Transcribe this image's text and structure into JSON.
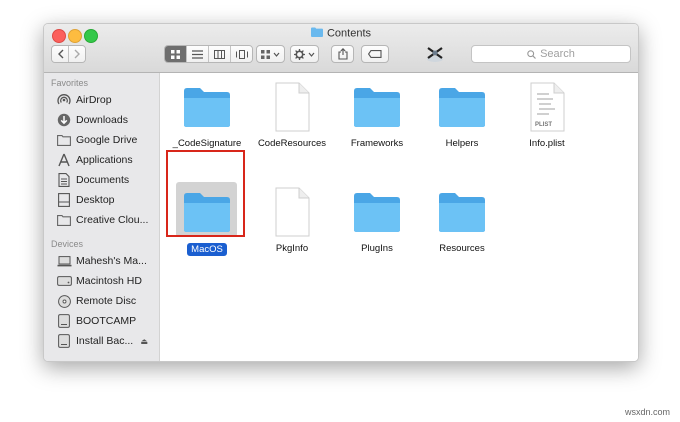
{
  "window": {
    "title": "Contents",
    "search_placeholder": "Search"
  },
  "sidebar": {
    "favorites_heading": "Favorites",
    "favorites": [
      {
        "label": "AirDrop",
        "icon": "airdrop-icon"
      },
      {
        "label": "Downloads",
        "icon": "downloads-icon"
      },
      {
        "label": "Google Drive",
        "icon": "folder-icon"
      },
      {
        "label": "Applications",
        "icon": "applications-icon"
      },
      {
        "label": "Documents",
        "icon": "documents-icon"
      },
      {
        "label": "Desktop",
        "icon": "desktop-icon"
      },
      {
        "label": "Creative Clou...",
        "icon": "folder-icon"
      }
    ],
    "devices_heading": "Devices",
    "devices": [
      {
        "label": "Mahesh's Ma...",
        "icon": "laptop-icon"
      },
      {
        "label": "Macintosh HD",
        "icon": "hard-drive-icon"
      },
      {
        "label": "Remote Disc",
        "icon": "disc-icon"
      },
      {
        "label": "BOOTCAMP",
        "icon": "drive-icon"
      },
      {
        "label": "Install Bac...",
        "icon": "drive-icon",
        "eject": "⏏"
      }
    ]
  },
  "files": [
    {
      "label": "_CodeSignature",
      "kind": "folder"
    },
    {
      "label": "CodeResources",
      "kind": "document"
    },
    {
      "label": "Frameworks",
      "kind": "folder"
    },
    {
      "label": "Helpers",
      "kind": "folder"
    },
    {
      "label": "Info.plist",
      "kind": "plist",
      "badge": "PLIST"
    },
    {
      "label": "MacOS",
      "kind": "folder",
      "selected": true
    },
    {
      "label": "PkgInfo",
      "kind": "document"
    },
    {
      "label": "PlugIns",
      "kind": "folder"
    },
    {
      "label": "Resources",
      "kind": "folder"
    }
  ],
  "colors": {
    "folder": "#5fb8f0",
    "selection": "#1b5fd0",
    "highlight_box": "#d8261a"
  },
  "watermark": "wsxdn.com"
}
